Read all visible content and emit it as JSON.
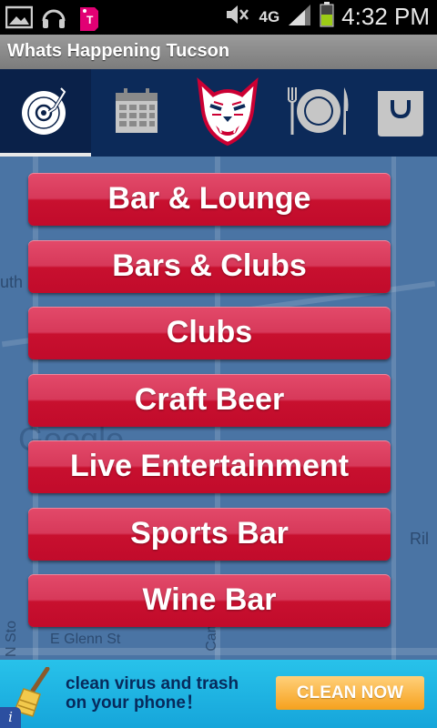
{
  "status_bar": {
    "network_label": "4G",
    "time": "4:32 PM",
    "icons": [
      "gallery-icon",
      "headset-icon",
      "tmobile-icon",
      "mute-icon",
      "data-icon",
      "signal-icon",
      "battery-icon"
    ]
  },
  "app": {
    "title": "Whats Happening Tucson"
  },
  "tabs": [
    {
      "name": "music",
      "icon": "turntable-icon",
      "active": true
    },
    {
      "name": "calendar",
      "icon": "calendar-icon",
      "active": false
    },
    {
      "name": "wildcats",
      "icon": "wildcat-logo-icon",
      "active": false
    },
    {
      "name": "dining",
      "icon": "plate-icon",
      "active": false
    },
    {
      "name": "shopping",
      "icon": "shopping-bag-icon",
      "active": false
    }
  ],
  "map": {
    "labels": [
      "uth",
      "Ril",
      "E Glenn St",
      "N Sto",
      "Cam",
      "Google"
    ]
  },
  "menu": {
    "items": [
      {
        "label": "Bar & Lounge"
      },
      {
        "label": "Bars & Clubs"
      },
      {
        "label": "Clubs"
      },
      {
        "label": "Craft Beer"
      },
      {
        "label": "Live Entertainment"
      },
      {
        "label": "Sports Bar"
      },
      {
        "label": "Wine Bar"
      }
    ]
  },
  "ad": {
    "line1": "clean virus and trash",
    "line2": "on your phone！",
    "cta": "CLEAN  NOW",
    "info": "i"
  },
  "colors": {
    "tab_bar": "#0c2a59",
    "button_red": "#c8102f",
    "map_blue": "#4a74a4",
    "ad_blue": "#1ab0e0",
    "cta_orange": "#f6a11d"
  }
}
